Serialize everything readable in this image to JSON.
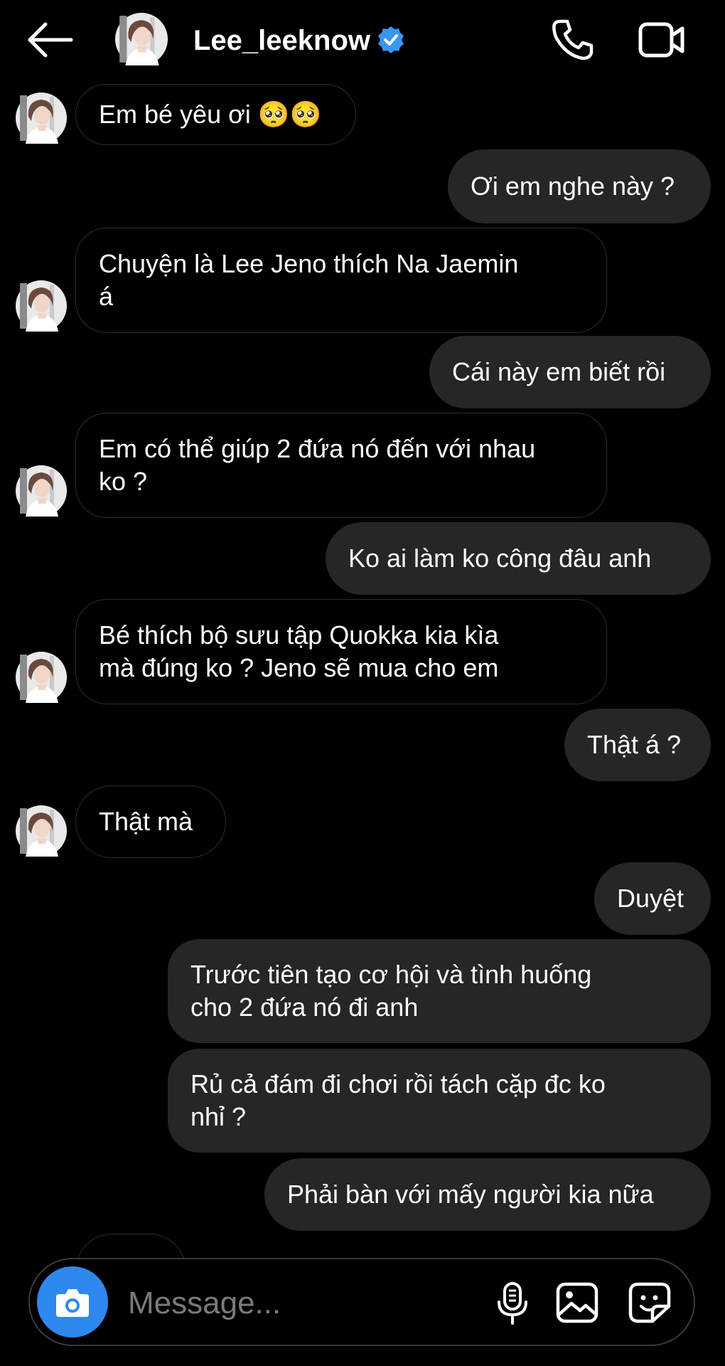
{
  "header": {
    "username": "Lee_leeknow",
    "verified_icon": "verified-badge-icon",
    "accent_color": "#3897f0"
  },
  "messages": [
    {
      "sender": "them",
      "text": "Em bé yêu ơi 🥺🥺"
    },
    {
      "sender": "me",
      "text": "Ơi em nghe này ?"
    },
    {
      "sender": "them",
      "lines": [
        "Chuyện là Lee Jeno thích Na Jaemin",
        "á"
      ]
    },
    {
      "sender": "me",
      "text": "Cái này em biết rồi"
    },
    {
      "sender": "them",
      "lines": [
        "Em có thể giúp 2 đứa nó đến với nhau",
        "ko ?"
      ]
    },
    {
      "sender": "me",
      "text": "Ko ai làm ko công đâu anh"
    },
    {
      "sender": "them",
      "lines": [
        "Bé thích bộ sưu tập Quokka kia kìa",
        "mà đúng ko ? Jeno sẽ mua cho em"
      ]
    },
    {
      "sender": "me",
      "text": "Thật á ?"
    },
    {
      "sender": "them",
      "text": "Thật mà"
    },
    {
      "sender": "me",
      "text": "Duyệt"
    },
    {
      "sender": "me",
      "lines": [
        "Trước tiên tạo cơ hội và tình huống",
        "cho 2 đứa nó đi anh"
      ]
    },
    {
      "sender": "me",
      "lines": [
        "Rủ cả đám đi chơi rồi tách cặp đc ko",
        "nhỉ ?"
      ]
    },
    {
      "sender": "me",
      "text": "Phải bàn với mấy người kia nữa"
    }
  ],
  "composer": {
    "placeholder": "Message...",
    "icons": [
      "camera-icon",
      "mic-icon",
      "gallery-icon",
      "sticker-icon"
    ],
    "camera_button_color": "#2f88ee"
  },
  "colors": {
    "background": "#000000",
    "outgoing_bubble": "#262626",
    "incoming_border": "#2e2e2e",
    "text": "#ffffff"
  }
}
